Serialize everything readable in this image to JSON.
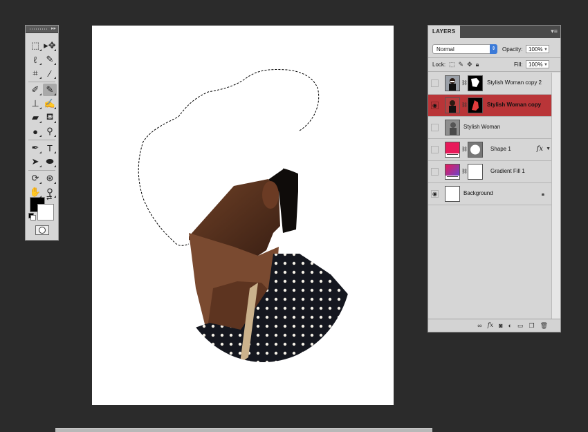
{
  "tools_panel": {
    "tools": [
      {
        "name": "rect-marquee-icon",
        "glyph": "⬚"
      },
      {
        "name": "move-icon",
        "glyph": "▸✥"
      },
      {
        "name": "lasso-icon",
        "glyph": "ℓ"
      },
      {
        "name": "quick-select-icon",
        "glyph": "✎"
      },
      {
        "name": "crop-icon",
        "glyph": "⌗"
      },
      {
        "name": "eyedropper-icon",
        "glyph": "⁄"
      },
      {
        "name": "healing-brush-icon",
        "glyph": "✐"
      },
      {
        "name": "brush-icon",
        "glyph": "✎"
      },
      {
        "name": "clone-stamp-icon",
        "glyph": "⊥"
      },
      {
        "name": "history-brush-icon",
        "glyph": "✍"
      },
      {
        "name": "eraser-icon",
        "glyph": "▰"
      },
      {
        "name": "paint-bucket-icon",
        "glyph": "⛾"
      },
      {
        "name": "blur-icon",
        "glyph": "●"
      },
      {
        "name": "dodge-icon",
        "glyph": "⚲"
      },
      {
        "name": "pen-icon",
        "glyph": "✒"
      },
      {
        "name": "type-icon",
        "glyph": "T"
      },
      {
        "name": "path-select-icon",
        "glyph": "➤"
      },
      {
        "name": "ellipse-shape-icon",
        "glyph": "⬬"
      },
      {
        "name": "3d-rotate-icon",
        "glyph": "⟳"
      },
      {
        "name": "3d-orbit-icon",
        "glyph": "⊛"
      },
      {
        "name": "hand-icon",
        "glyph": "✋"
      },
      {
        "name": "zoom-icon",
        "glyph": "⚲"
      }
    ],
    "active_tool": "brush-icon",
    "foreground_color": "#000000",
    "background_color": "#ffffff"
  },
  "layers_panel": {
    "tab_label": "LAYERS",
    "blend_mode": "Normal",
    "opacity_label": "Opacity:",
    "opacity_value": "100%",
    "lock_label": "Lock:",
    "fill_label": "Fill:",
    "fill_value": "100%",
    "layers": [
      {
        "name": "Stylish Woman copy 2",
        "visible": false,
        "selected": false,
        "has_mask": true
      },
      {
        "name": "Stylish Woman copy",
        "visible": true,
        "selected": true,
        "has_mask": true
      },
      {
        "name": "Stylish Woman",
        "visible": false,
        "selected": false,
        "has_mask": false
      },
      {
        "name": "Shape 1",
        "visible": false,
        "selected": false,
        "has_mask": true,
        "fx": "fx"
      },
      {
        "name": "Gradient Fill 1",
        "visible": false,
        "selected": false,
        "has_mask": true
      },
      {
        "name": "Background",
        "visible": true,
        "selected": false,
        "has_mask": false,
        "locked": true
      }
    ],
    "footer_icons": [
      "link-icon",
      "fx-icon",
      "mask-icon",
      "adjustment-icon",
      "group-icon",
      "new-layer-icon",
      "trash-icon"
    ]
  },
  "colors": {
    "app_bg": "#2b2b2b",
    "panel_bg": "#d6d6d6",
    "selected_layer": "#b93538",
    "shape_fill": "#e8195a",
    "gradient_start": "#e8195a",
    "gradient_end": "#5b4bd6"
  }
}
